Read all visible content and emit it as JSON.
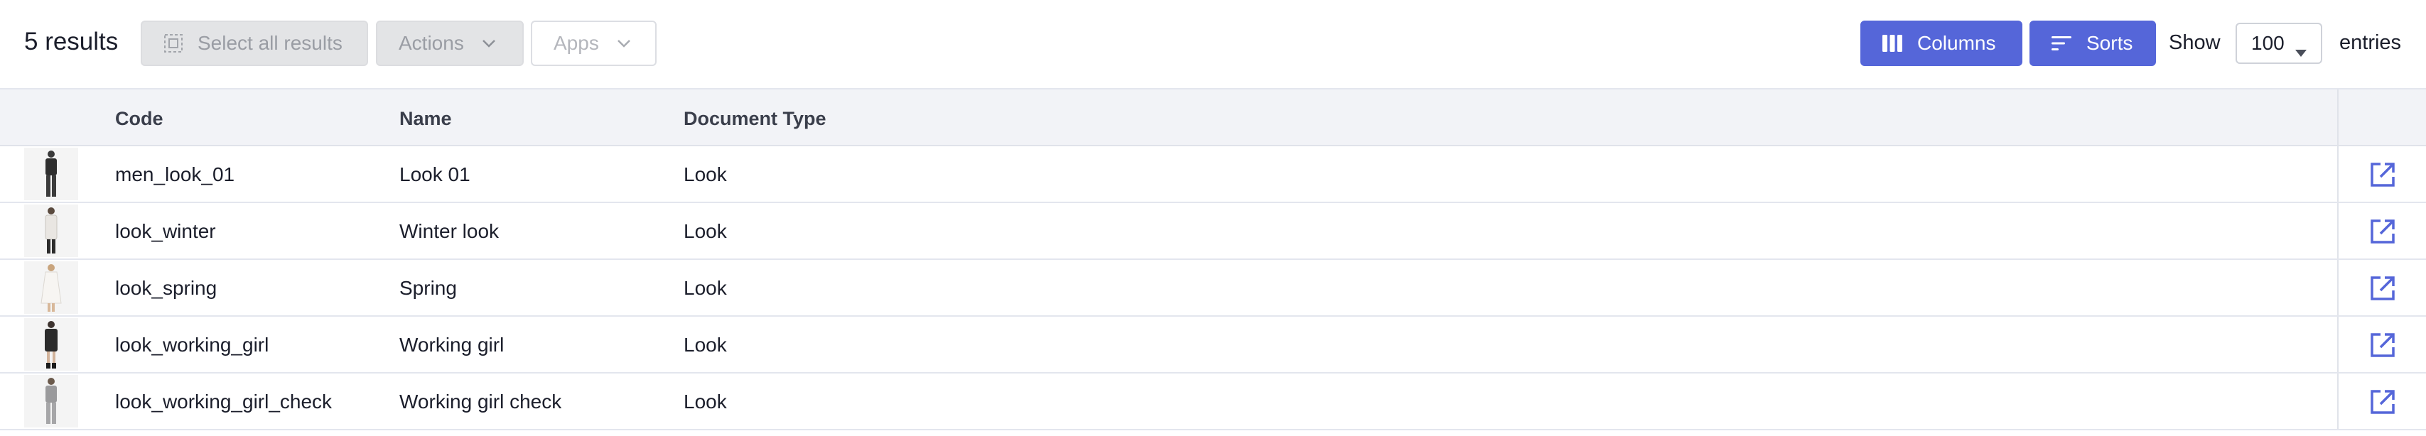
{
  "toolbar": {
    "results_count": "5 results",
    "select_all_label": "Select all results",
    "actions_label": "Actions",
    "apps_label": "Apps",
    "columns_label": "Columns",
    "sorts_label": "Sorts",
    "show_label": "Show",
    "entries_value": "100",
    "entries_label": "entries"
  },
  "table": {
    "headers": {
      "code": "Code",
      "name": "Name",
      "document_type": "Document Type"
    },
    "rows": [
      {
        "code": "men_look_01",
        "name": "Look 01",
        "document_type": "Look",
        "thumbnail": "dark-suit-look"
      },
      {
        "code": "look_winter",
        "name": "Winter look",
        "document_type": "Look",
        "thumbnail": "winter-coat-look"
      },
      {
        "code": "look_spring",
        "name": "Spring",
        "document_type": "Look",
        "thumbnail": "white-dress-look"
      },
      {
        "code": "look_working_girl",
        "name": "Working girl",
        "document_type": "Look",
        "thumbnail": "dark-dress-look"
      },
      {
        "code": "look_working_girl_check",
        "name": "Working girl check",
        "document_type": "Look",
        "thumbnail": "grey-suit-look"
      }
    ]
  },
  "colors": {
    "primary": "#5566d9",
    "disabled_bg": "#e3e4e6",
    "header_bg": "#f2f3f7"
  },
  "icons": {
    "select_all": "select-all-icon",
    "chevron": "chevron-down-icon",
    "columns": "columns-icon",
    "sorts": "sort-lines-icon",
    "caret": "caret-down-icon",
    "open": "open-external-icon"
  }
}
